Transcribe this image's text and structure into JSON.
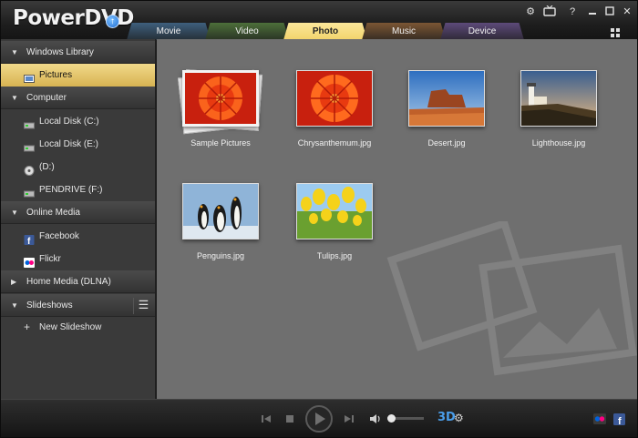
{
  "app": {
    "logo_text": "PowerDVD",
    "upgrade_glyph": "↑"
  },
  "window_buttons": {
    "settings_icon": "⚙",
    "tv_icon": "⎕",
    "help": "?",
    "minimize": "□",
    "maximize": "□",
    "close": "✕"
  },
  "tabs": [
    {
      "label": "Movie",
      "color": "#3e5f7d",
      "active": false
    },
    {
      "label": "Video",
      "color": "#4d6f3a",
      "active": false
    },
    {
      "label": "Photo",
      "color": "#f2d36b",
      "active": true
    },
    {
      "label": "Music",
      "color": "#7b5634",
      "active": false
    },
    {
      "label": "Device",
      "color": "#5d4a7a",
      "active": false
    }
  ],
  "sidebar": {
    "windows_library": {
      "label": "Windows Library",
      "items": [
        {
          "label": "Pictures"
        }
      ]
    },
    "computer": {
      "label": "Computer",
      "items": [
        {
          "label": "Local Disk (C:)"
        },
        {
          "label": "Local Disk (E:)"
        },
        {
          "label": "(D:)"
        },
        {
          "label": "PENDRIVE (F:)"
        }
      ]
    },
    "online_media": {
      "label": "Online Media",
      "items": [
        {
          "label": "Facebook"
        },
        {
          "label": "Flickr"
        }
      ]
    },
    "home_media": {
      "label": "Home Media (DLNA)"
    },
    "slideshows": {
      "label": "Slideshows",
      "items": [
        {
          "label": "New Slideshow"
        }
      ]
    }
  },
  "photos": [
    {
      "caption": "Sample Pictures"
    },
    {
      "caption": "Chrysanthemum.jpg"
    },
    {
      "caption": "Desert.jpg"
    },
    {
      "caption": "Lighthouse.jpg"
    },
    {
      "caption": "Penguins.jpg"
    },
    {
      "caption": "Tulips.jpg"
    }
  ],
  "controls": {
    "three_d_label": "3D",
    "facebook_glyph": "f"
  }
}
